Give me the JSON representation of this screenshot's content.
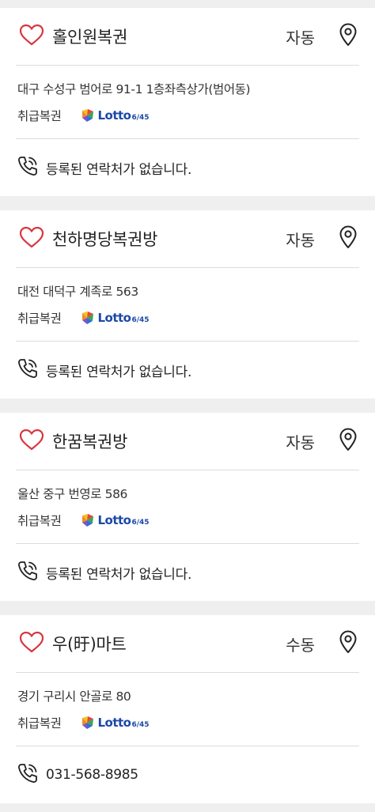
{
  "colors": {
    "heart": "#d9353f",
    "lotto_blue": "#1c49a8",
    "background": "#efefef"
  },
  "stores": [
    {
      "name": "홀인원복권",
      "mode": "자동",
      "address": "대구 수성구 범어로 91-1 1층좌측상가(범어동)",
      "type": "취급복권",
      "lotto_word": "Lotto",
      "lotto_num": "6/45",
      "contact": "등록된 연락처가 없습니다.",
      "icons": [
        "heart-icon",
        "map-pin-icon",
        "phone-icon",
        "lotto-logo"
      ]
    },
    {
      "name": "천하명당복권방",
      "mode": "자동",
      "address": "대전 대덕구 계족로 563",
      "type": "취급복권",
      "lotto_word": "Lotto",
      "lotto_num": "6/45",
      "contact": "등록된 연락처가 없습니다.",
      "icons": [
        "heart-icon",
        "map-pin-icon",
        "phone-icon",
        "lotto-logo"
      ]
    },
    {
      "name": "한꿈복권방",
      "mode": "자동",
      "address": "울산 중구 번영로 586",
      "type": "취급복권",
      "lotto_word": "Lotto",
      "lotto_num": "6/45",
      "contact": "등록된 연락처가 없습니다.",
      "icons": [
        "heart-icon",
        "map-pin-icon",
        "phone-icon",
        "lotto-logo"
      ]
    },
    {
      "name": "우(旴)마트",
      "mode": "수동",
      "address": "경기 구리시 안골로 80",
      "type": "취급복권",
      "lotto_word": "Lotto",
      "lotto_num": "6/45",
      "contact": "031-568-8985",
      "icons": [
        "heart-icon",
        "map-pin-icon",
        "phone-icon",
        "lotto-logo"
      ]
    }
  ]
}
